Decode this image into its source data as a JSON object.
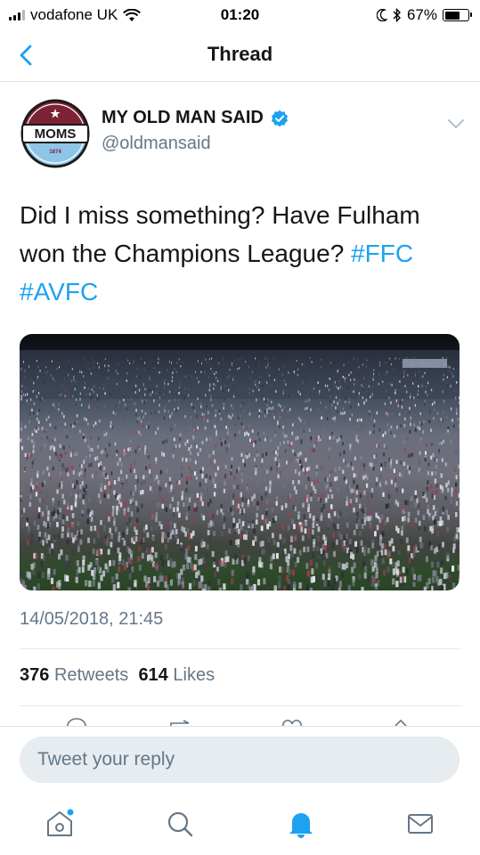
{
  "status_bar": {
    "carrier": "vodafone UK",
    "time": "01:20",
    "battery_percent": "67%",
    "battery_level": 0.67
  },
  "nav": {
    "title": "Thread",
    "back_icon": "chevron-left-icon"
  },
  "tweet": {
    "author_name": "MY OLD MAN SAID",
    "author_handle": "@oldmansaid",
    "avatar_text": "MOMS",
    "avatar_year": "1874",
    "verified": true,
    "text_before": "Did I miss something? Have Fulham won the Champions League? ",
    "hashtag1": "#FFC",
    "hashtag2": "#AVFC",
    "timestamp": "14/05/2018, 21:45",
    "retweets_count": "376",
    "retweets_label": "Retweets",
    "likes_count": "614",
    "likes_label": "Likes"
  },
  "reply": {
    "placeholder": "Tweet your reply"
  },
  "tabbar": {
    "items": [
      "home-icon",
      "search-icon",
      "notifications-icon",
      "messages-icon"
    ],
    "active": "notifications-icon"
  },
  "colors": {
    "accent": "#1da1f2",
    "secondary_text": "#657786",
    "avatar_maroon": "#7b2335",
    "avatar_blue": "#8ec5e6"
  }
}
